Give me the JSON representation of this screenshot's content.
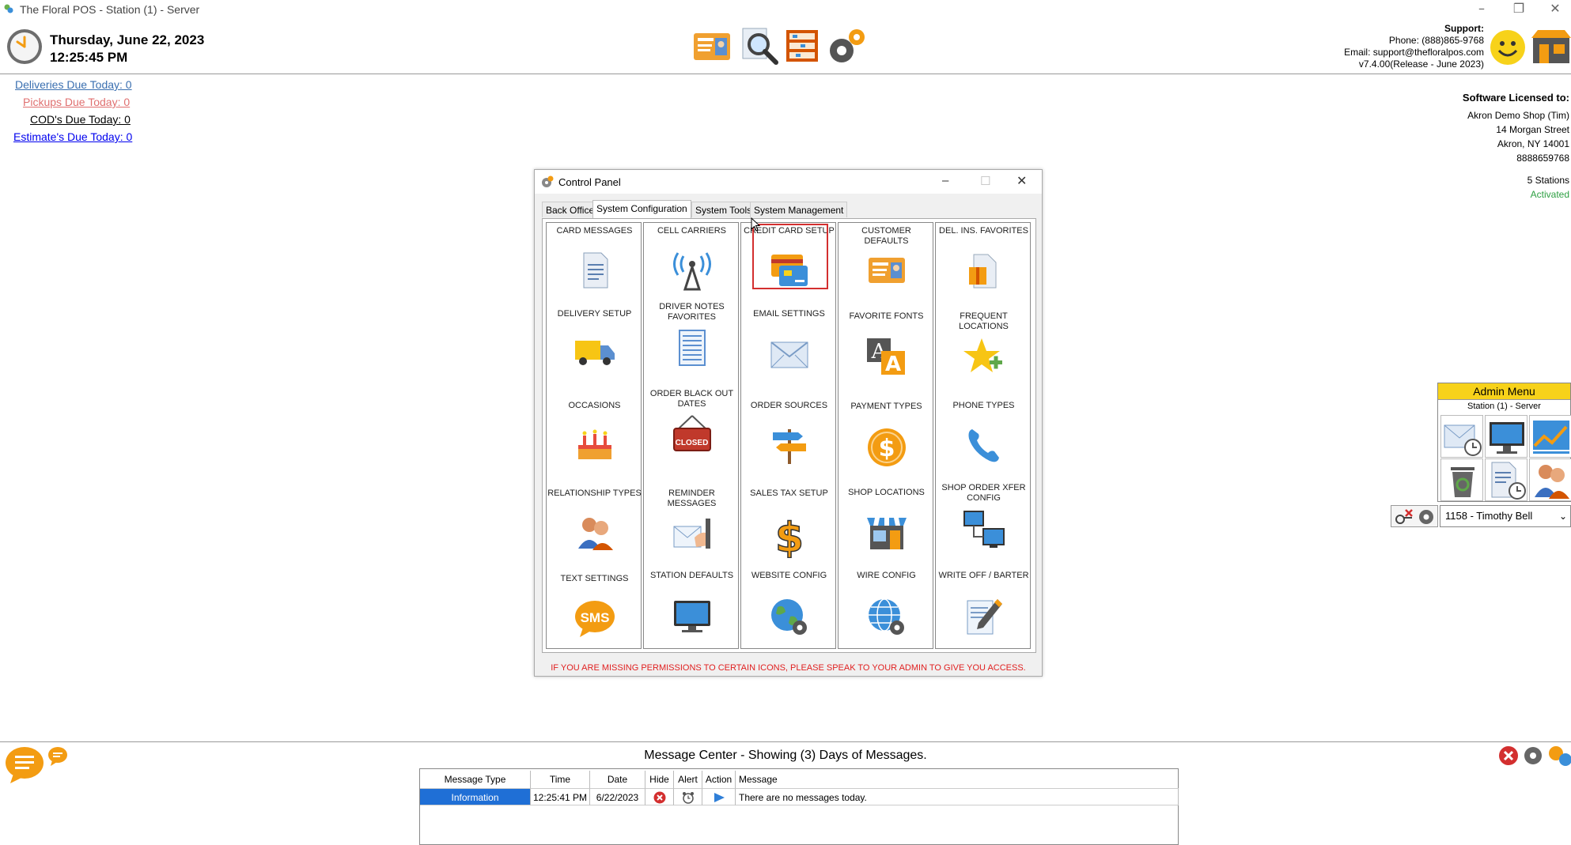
{
  "window": {
    "title": "The Floral POS - Station (1) - Server",
    "min": "–",
    "restore": "❐",
    "close": "✕"
  },
  "header": {
    "date": "Thursday, June 22, 2023",
    "time": "12:25:45 PM",
    "toolbar_icons": [
      "customer-card-icon",
      "search-icon",
      "cabinet-icon",
      "settings-gears-icon"
    ],
    "support": {
      "label": "Support:",
      "phone": "Phone: (888)865-9768",
      "email": "Email: support@thefloralpos.com",
      "version": "v7.4.00(Release - June 2023)"
    }
  },
  "due": {
    "deliveries": "Deliveries Due Today: 0",
    "pickups": "Pickups Due Today: 0",
    "cods": "COD's Due Today: 0",
    "estimates": "Estimate's Due Today: 0",
    "colors": {
      "deliveries": "#3a6fb0",
      "pickups": "#e07070",
      "cods": "#000000",
      "estimates": "#0000ee"
    }
  },
  "license": {
    "label": "Software Licensed to:",
    "shop": "Akron Demo Shop (Tim)",
    "street": "14 Morgan Street",
    "city": "Akron, NY 14001",
    "phone": "8888659768",
    "stations": "5 Stations",
    "status": "Activated",
    "status_color": "#2ea043"
  },
  "control_panel": {
    "title": "Control Panel",
    "close": "✕",
    "min": "–",
    "max": "☐",
    "tabs": [
      "Back Office",
      "System Configuration",
      "System Tools",
      "System Management"
    ],
    "active_tab": 1,
    "items": [
      {
        "label": "CARD MESSAGES",
        "icon": "document-icon"
      },
      {
        "label": "DELIVERY SETUP",
        "icon": "delivery-truck-icon"
      },
      {
        "label": "OCCASIONS",
        "icon": "birthday-cake-icon"
      },
      {
        "label": "RELATIONSHIP TYPES",
        "icon": "people-icon"
      },
      {
        "label": "TEXT SETTINGS",
        "icon": "sms-icon"
      },
      {
        "label": "CELL CARRIERS",
        "icon": "cell-tower-icon"
      },
      {
        "label": "DRIVER NOTES FAVORITES",
        "icon": "notepad-icon"
      },
      {
        "label": "ORDER BLACK OUT DATES",
        "icon": "closed-sign-icon",
        "badge": "CLOSED"
      },
      {
        "label": "REMINDER MESSAGES",
        "icon": "envelope-hand-icon"
      },
      {
        "label": "STATION DEFAULTS",
        "icon": "monitor-icon"
      },
      {
        "label": "CREDIT CARD SETUP",
        "icon": "credit-card-icon"
      },
      {
        "label": "EMAIL SETTINGS",
        "icon": "email-icon"
      },
      {
        "label": "ORDER SOURCES",
        "icon": "signpost-icon"
      },
      {
        "label": "SALES TAX SETUP",
        "icon": "dollar-sign-icon"
      },
      {
        "label": "WEBSITE CONFIG",
        "icon": "globe-gear-icon"
      },
      {
        "label": "CUSTOMER DEFAULTS",
        "icon": "id-card-icon"
      },
      {
        "label": "FAVORITE FONTS",
        "icon": "fonts-icon"
      },
      {
        "label": "PAYMENT TYPES",
        "icon": "dollar-coin-icon"
      },
      {
        "label": "SHOP LOCATIONS",
        "icon": "storefront-icon"
      },
      {
        "label": "WIRE CONFIG",
        "icon": "globe-network-icon"
      },
      {
        "label": "DEL. INS. FAVORITES",
        "icon": "package-icon"
      },
      {
        "label": "FREQUENT LOCATIONS",
        "icon": "star-plus-icon"
      },
      {
        "label": "PHONE TYPES",
        "icon": "phone-icon"
      },
      {
        "label": "SHOP ORDER XFER CONFIG",
        "icon": "computers-transfer-icon"
      },
      {
        "label": "WRITE OFF / BARTER",
        "icon": "write-off-icon"
      }
    ],
    "selected_item": "CREDIT CARD SETUP",
    "warning": "IF YOU ARE MISSING PERMISSIONS TO CERTAIN ICONS, PLEASE SPEAK TO YOUR ADMIN TO GIVE YOU ACCESS."
  },
  "admin_menu": {
    "title": "Admin Menu",
    "station": "Station (1) - Server",
    "icons": [
      "email-clock-icon",
      "monitor-icon",
      "chart-icon",
      "recycle-bin-icon",
      "document-clock-icon",
      "users-icon"
    ],
    "user": "1158 - Timothy Bell",
    "dropdown_arrow": "⌄"
  },
  "message_center": {
    "title": "Message Center - Showing (3) Days of Messages.",
    "columns": [
      "Message Type",
      "Time",
      "Date",
      "Hide",
      "Alert",
      "Action",
      "Message"
    ],
    "row": {
      "type": "Information",
      "time": "12:25:41 PM",
      "date": "6/22/2023",
      "message": "There are no messages today."
    }
  }
}
